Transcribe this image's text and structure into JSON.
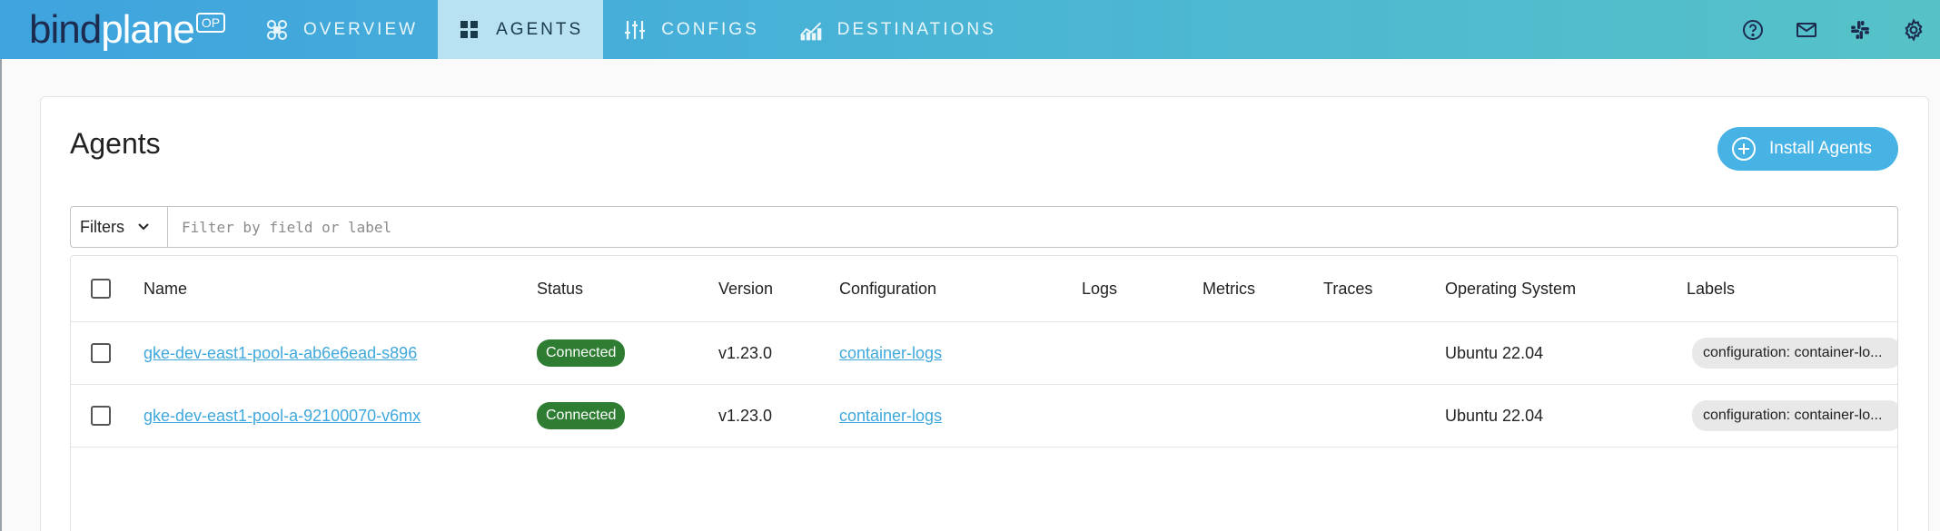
{
  "brand": {
    "word_dark": "bind",
    "word_light": "plane",
    "badge": "OP"
  },
  "nav": {
    "items": [
      {
        "label": "OVERVIEW",
        "icon": "overview-icon"
      },
      {
        "label": "AGENTS",
        "icon": "agents-grid-icon",
        "active": true
      },
      {
        "label": "CONFIGS",
        "icon": "sliders-icon"
      },
      {
        "label": "DESTINATIONS",
        "icon": "chart-icon"
      }
    ],
    "right_icons": [
      "help-icon",
      "mail-icon",
      "slack-icon",
      "gear-icon"
    ]
  },
  "page": {
    "title": "Agents",
    "install_button": "Install Agents"
  },
  "filter": {
    "dropdown_label": "Filters",
    "placeholder": "Filter by field or label"
  },
  "table": {
    "columns": [
      "Name",
      "Status",
      "Version",
      "Configuration",
      "Logs",
      "Metrics",
      "Traces",
      "Operating System",
      "Labels"
    ],
    "rows": [
      {
        "name": "gke-dev-east1-pool-a-ab6e6ead-s896",
        "status": "Connected",
        "version": "v1.23.0",
        "configuration": "container-logs",
        "logs": "",
        "metrics": "",
        "traces": "",
        "os": "Ubuntu 22.04",
        "labels": "configuration: container-lo..."
      },
      {
        "name": "gke-dev-east1-pool-a-92100070-v6mx",
        "status": "Connected",
        "version": "v1.23.0",
        "configuration": "container-logs",
        "logs": "",
        "metrics": "",
        "traces": "",
        "os": "Ubuntu 22.04",
        "labels": "configuration: container-lo..."
      }
    ]
  },
  "colors": {
    "nav_gradient_start": "#3fa3de",
    "nav_gradient_end": "#56c2c7",
    "nav_active": "#b8e2f2",
    "accent": "#47b2e4",
    "link": "#3fa8dc",
    "status_connected": "#2e7d32"
  }
}
